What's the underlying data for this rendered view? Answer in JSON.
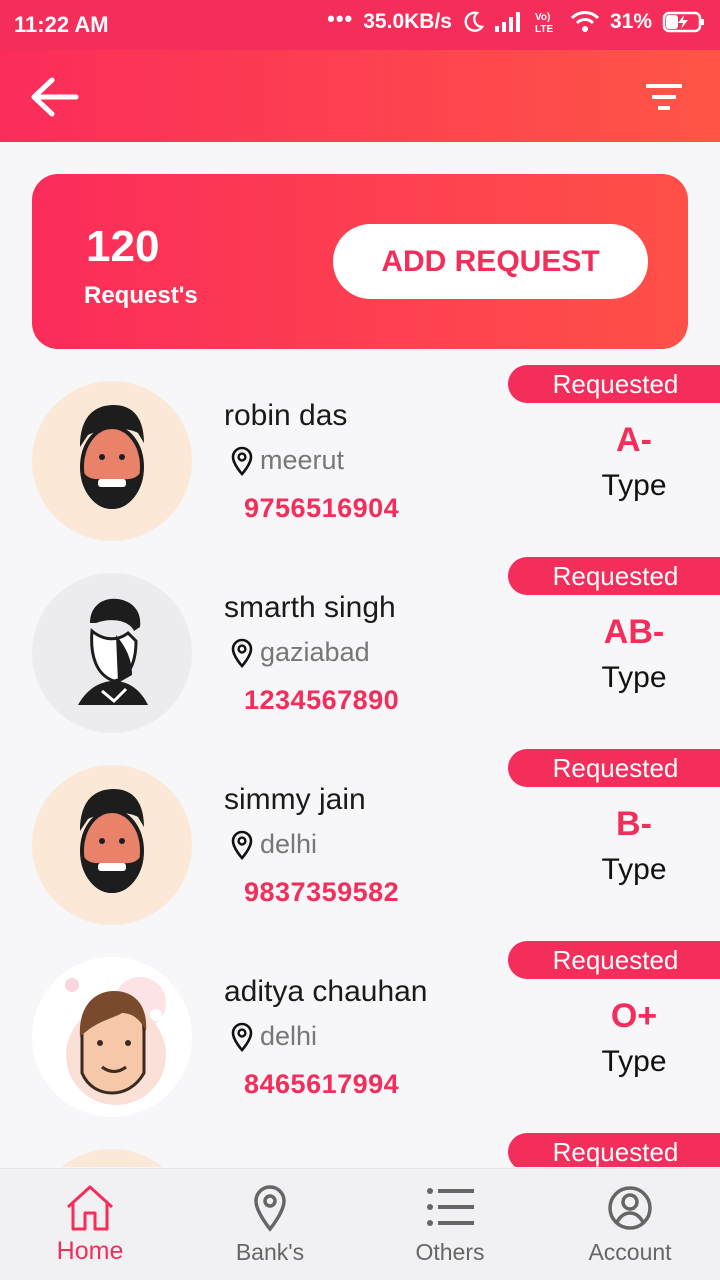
{
  "status_bar": {
    "time": "11:22 AM",
    "dots": "•••",
    "speed": "35.0KB/s",
    "battery": "31%",
    "icons": [
      "moon-icon",
      "signal-icon",
      "volte-icon",
      "wifi-icon",
      "battery-charging-icon"
    ]
  },
  "app_bar": {
    "back_icon": "arrow-left-icon",
    "filter_icon": "filter-icon"
  },
  "summary": {
    "count": "120",
    "count_label": "Request's",
    "add_button": "ADD REQUEST"
  },
  "requests": [
    {
      "name": "robin das",
      "location": "meerut",
      "phone": "9756516904",
      "status": "Requested",
      "blood_group": "A-",
      "type_label": "Type",
      "avatar": "bearded-man-avatar"
    },
    {
      "name": "smarth singh",
      "location": "gaziabad",
      "phone": "1234567890",
      "status": "Requested",
      "blood_group": "AB-",
      "type_label": "Type",
      "avatar": "sketch-man-avatar"
    },
    {
      "name": "simmy jain",
      "location": "delhi",
      "phone": "9837359582",
      "status": "Requested",
      "blood_group": "B-",
      "type_label": "Type",
      "avatar": "bearded-man-avatar"
    },
    {
      "name": "aditya chauhan",
      "location": "delhi",
      "phone": "8465617994",
      "status": "Requested",
      "blood_group": "O+",
      "type_label": "Type",
      "avatar": "cartoon-man-avatar"
    },
    {
      "name": "",
      "location": "",
      "phone": "",
      "status": "Requested",
      "blood_group": "",
      "type_label": "",
      "avatar": "bearded-man-avatar"
    }
  ],
  "bottom_nav": [
    {
      "label": "Home",
      "icon": "home-icon",
      "active": true
    },
    {
      "label": "Bank's",
      "icon": "location-pin-icon",
      "active": false
    },
    {
      "label": "Others",
      "icon": "list-icon",
      "active": false
    },
    {
      "label": "Account",
      "icon": "account-circle-icon",
      "active": false
    }
  ],
  "colors": {
    "accent": "#f42d5a",
    "accent_end": "#ff5546",
    "background": "#f7f7f9"
  }
}
